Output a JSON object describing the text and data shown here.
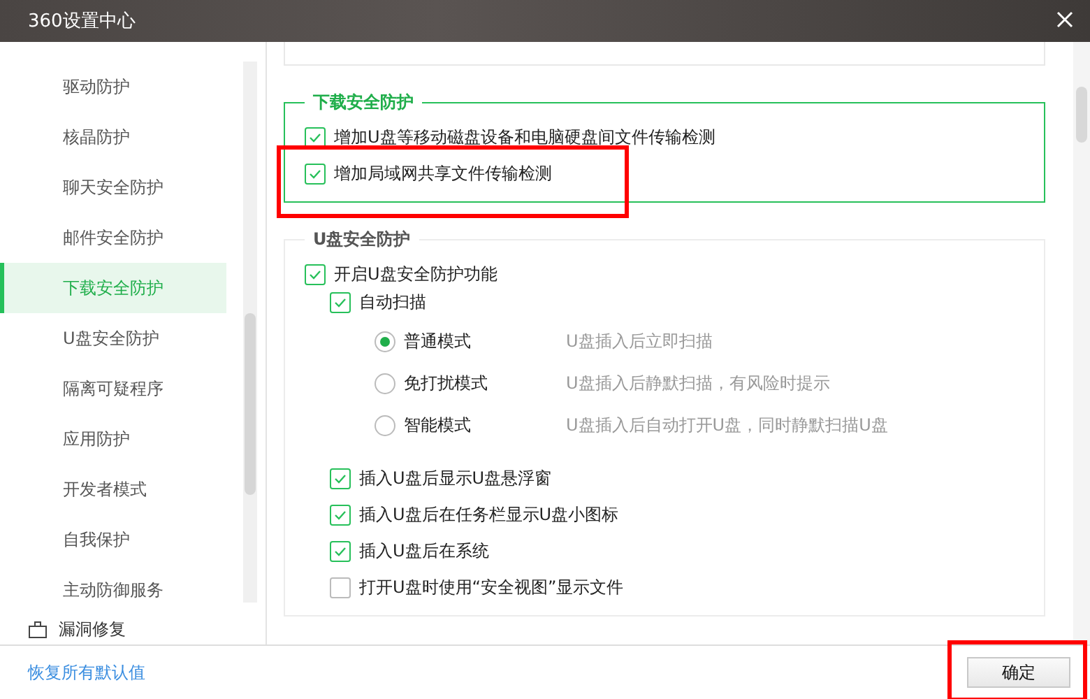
{
  "window": {
    "title": "360设置中心"
  },
  "sidebar": {
    "items": [
      {
        "label": "驱动防护",
        "selected": false
      },
      {
        "label": "核晶防护",
        "selected": false
      },
      {
        "label": "聊天安全防护",
        "selected": false
      },
      {
        "label": "邮件安全防护",
        "selected": false
      },
      {
        "label": "下载安全防护",
        "selected": true
      },
      {
        "label": "U盘安全防护",
        "selected": false
      },
      {
        "label": "隔离可疑程序",
        "selected": false
      },
      {
        "label": "应用防护",
        "selected": false
      },
      {
        "label": "开发者模式",
        "selected": false
      },
      {
        "label": "自我保护",
        "selected": false
      },
      {
        "label": "主动防御服务",
        "selected": false
      }
    ],
    "group": {
      "label": "漏洞修复"
    }
  },
  "download_section": {
    "title": "下载安全防护",
    "options": [
      {
        "label": "增加U盘等移动磁盘设备和电脑硬盘间文件传输检测",
        "checked": true,
        "highlighted": false
      },
      {
        "label": "增加局域网共享文件传输检测",
        "checked": true,
        "highlighted": true
      }
    ]
  },
  "usb_section": {
    "title": "U盘安全防护",
    "main": {
      "label": "开启U盘安全防护功能",
      "checked": true
    },
    "auto_scan": {
      "label": "自动扫描",
      "checked": true
    },
    "modes": [
      {
        "label": "普通模式",
        "description": "U盘插入后立即扫描",
        "selected": true
      },
      {
        "label": "免打扰模式",
        "description": "U盘插入后静默扫描，有风险时提示",
        "selected": false
      },
      {
        "label": "智能模式",
        "description": "U盘插入后自动打开U盘，同时静默扫描U盘",
        "selected": false
      }
    ],
    "options": [
      {
        "label": "插入U盘后显示U盘悬浮窗",
        "checked": true
      },
      {
        "label": "插入U盘后在任务栏显示U盘小图标",
        "checked": true
      },
      {
        "label": "插入U盘后在系统",
        "checked": true
      },
      {
        "label": "打开U盘时使用“安全视图”显示文件",
        "checked": false
      }
    ]
  },
  "footer": {
    "reset_link": "恢复所有默认值",
    "ok_button": {
      "label": "确定",
      "highlighted": true
    }
  }
}
